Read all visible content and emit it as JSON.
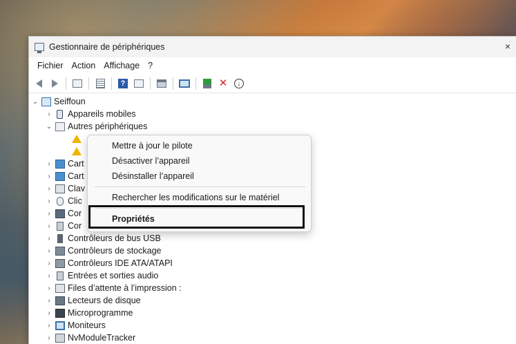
{
  "window": {
    "title": "Gestionnaire de périphériques",
    "close_glyph": "×"
  },
  "menubar": {
    "items": [
      "Fichier",
      "Action",
      "Affichage",
      "?"
    ]
  },
  "toolbar": {
    "icons": [
      "back-icon",
      "forward-icon",
      "console-tree-icon",
      "properties-list-icon",
      "help-icon",
      "action-pane-icon",
      "print-icon",
      "scan-hardware-icon",
      "update-driver-icon",
      "uninstall-icon",
      "disable-device-icon"
    ],
    "help_glyph": "?",
    "uninstall_glyph": "✕",
    "disable_glyph": "↓"
  },
  "tree": {
    "root": "Seiffoun",
    "expanded_glyph": "⌄",
    "collapsed_glyph": "›",
    "items": [
      {
        "label": "Appareils mobiles",
        "icon": "phone-icon"
      },
      {
        "label": "Autres périphériques",
        "icon": "unknown-device-icon"
      },
      {
        "label": "Cartes graphiques",
        "visible": "Cart",
        "icon": "card-icon"
      },
      {
        "label": "Cartes réseau",
        "visible": "Cart",
        "icon": "card-icon"
      },
      {
        "label": "Claviers",
        "visible": "Clav",
        "icon": "keyboard-icon"
      },
      {
        "label": "Clics",
        "visible": "Clic",
        "icon": "mouse-icon"
      },
      {
        "label": "Contrôleurs",
        "visible": "Cor",
        "icon": "controller-icon"
      },
      {
        "label": "Contrôleurs audio",
        "visible": "Cor",
        "icon": "audio-icon"
      },
      {
        "label": "Contrôleurs de bus USB",
        "icon": "usb-icon"
      },
      {
        "label": "Contrôleurs de stockage",
        "icon": "storage-icon"
      },
      {
        "label": "Contrôleurs IDE ATA/ATAPI",
        "icon": "ide-icon"
      },
      {
        "label": "Entrées et sorties audio",
        "icon": "audio-icon"
      },
      {
        "label": "Files d’attente à l’impression :",
        "icon": "printer-icon"
      },
      {
        "label": "Lecteurs de disque",
        "icon": "disk-icon"
      },
      {
        "label": "Microprogramme",
        "icon": "chip-icon"
      },
      {
        "label": "Moniteurs",
        "icon": "monitor-icon"
      },
      {
        "label": "NvModuleTracker",
        "icon": "module-icon"
      }
    ]
  },
  "context_menu": {
    "update_driver": "Mettre à jour le pilote",
    "disable": "Désactiver l’appareil",
    "uninstall": "Désinstaller l’appareil",
    "scan": "Rechercher les modifications sur le matériel",
    "properties": "Propriétés"
  }
}
